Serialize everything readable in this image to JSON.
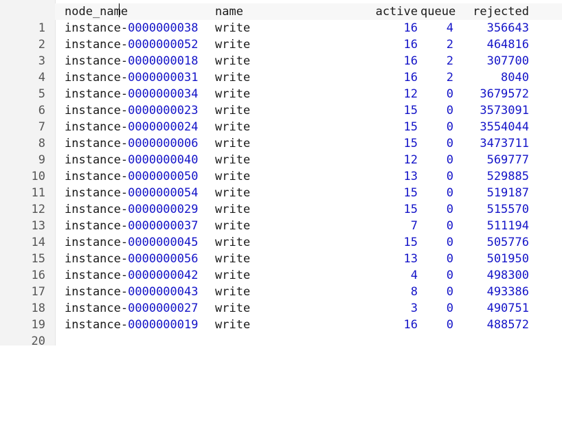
{
  "header": {
    "line_number": "1",
    "node_name": "node_name",
    "name": "name",
    "active": "active",
    "queue": "queue",
    "rejected": "rejected"
  },
  "rows": [
    {
      "ln": "2",
      "prefix": "instance-",
      "id": "0000000038",
      "name": "write",
      "active": "16",
      "queue": "4",
      "rejected": "356643"
    },
    {
      "ln": "3",
      "prefix": "instance-",
      "id": "0000000052",
      "name": "write",
      "active": "16",
      "queue": "2",
      "rejected": "464816"
    },
    {
      "ln": "4",
      "prefix": "instance-",
      "id": "0000000018",
      "name": "write",
      "active": "16",
      "queue": "2",
      "rejected": "307700"
    },
    {
      "ln": "5",
      "prefix": "instance-",
      "id": "0000000031",
      "name": "write",
      "active": "16",
      "queue": "2",
      "rejected": "8040"
    },
    {
      "ln": "6",
      "prefix": "instance-",
      "id": "0000000034",
      "name": "write",
      "active": "12",
      "queue": "0",
      "rejected": "3679572"
    },
    {
      "ln": "7",
      "prefix": "instance-",
      "id": "0000000023",
      "name": "write",
      "active": "15",
      "queue": "0",
      "rejected": "3573091"
    },
    {
      "ln": "8",
      "prefix": "instance-",
      "id": "0000000024",
      "name": "write",
      "active": "15",
      "queue": "0",
      "rejected": "3554044"
    },
    {
      "ln": "9",
      "prefix": "instance-",
      "id": "0000000006",
      "name": "write",
      "active": "15",
      "queue": "0",
      "rejected": "3473711"
    },
    {
      "ln": "10",
      "prefix": "instance-",
      "id": "0000000040",
      "name": "write",
      "active": "12",
      "queue": "0",
      "rejected": "569777"
    },
    {
      "ln": "11",
      "prefix": "instance-",
      "id": "0000000050",
      "name": "write",
      "active": "13",
      "queue": "0",
      "rejected": "529885"
    },
    {
      "ln": "12",
      "prefix": "instance-",
      "id": "0000000054",
      "name": "write",
      "active": "15",
      "queue": "0",
      "rejected": "519187"
    },
    {
      "ln": "13",
      "prefix": "instance-",
      "id": "0000000029",
      "name": "write",
      "active": "15",
      "queue": "0",
      "rejected": "515570"
    },
    {
      "ln": "14",
      "prefix": "instance-",
      "id": "0000000037",
      "name": "write",
      "active": "7",
      "queue": "0",
      "rejected": "511194"
    },
    {
      "ln": "15",
      "prefix": "instance-",
      "id": "0000000045",
      "name": "write",
      "active": "15",
      "queue": "0",
      "rejected": "505776"
    },
    {
      "ln": "16",
      "prefix": "instance-",
      "id": "0000000056",
      "name": "write",
      "active": "13",
      "queue": "0",
      "rejected": "501950"
    },
    {
      "ln": "17",
      "prefix": "instance-",
      "id": "0000000042",
      "name": "write",
      "active": "4",
      "queue": "0",
      "rejected": "498300"
    },
    {
      "ln": "18",
      "prefix": "instance-",
      "id": "0000000043",
      "name": "write",
      "active": "8",
      "queue": "0",
      "rejected": "493386"
    },
    {
      "ln": "19",
      "prefix": "instance-",
      "id": "0000000027",
      "name": "write",
      "active": "3",
      "queue": "0",
      "rejected": "490751"
    },
    {
      "ln": "20",
      "prefix": "instance-",
      "id": "0000000019",
      "name": "write",
      "active": "16",
      "queue": "0",
      "rejected": "488572"
    }
  ],
  "colors": {
    "number_highlight": "#1414c8",
    "text": "#1a1a1a",
    "gutter": "#f3f3f3"
  }
}
